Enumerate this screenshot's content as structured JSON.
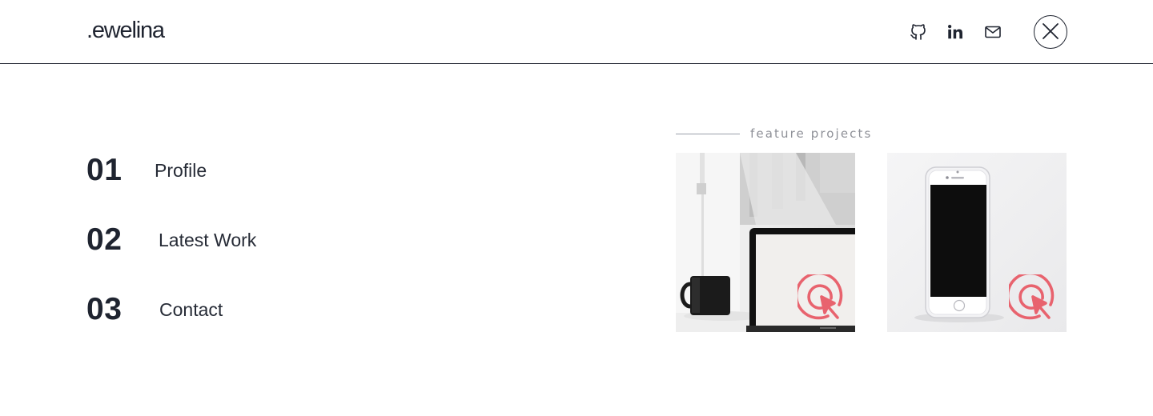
{
  "header": {
    "logo": ".ewelina",
    "social": [
      {
        "name": "github-icon"
      },
      {
        "name": "linkedin-icon"
      },
      {
        "name": "mail-icon"
      }
    ],
    "close_icon": "close-icon"
  },
  "menu": {
    "items": [
      {
        "number": "01",
        "label": "Profile"
      },
      {
        "number": "02",
        "label": "Latest Work"
      },
      {
        "number": "03",
        "label": "Contact"
      }
    ]
  },
  "featured": {
    "heading": "feature projects",
    "projects": [
      {
        "scene": "laptop-desk",
        "icon": "tap-cursor-icon"
      },
      {
        "scene": "smartphone",
        "icon": "tap-cursor-icon"
      }
    ]
  },
  "colors": {
    "text": "#1f2430",
    "accent": "#e8636e",
    "muted": "#8e9097"
  }
}
